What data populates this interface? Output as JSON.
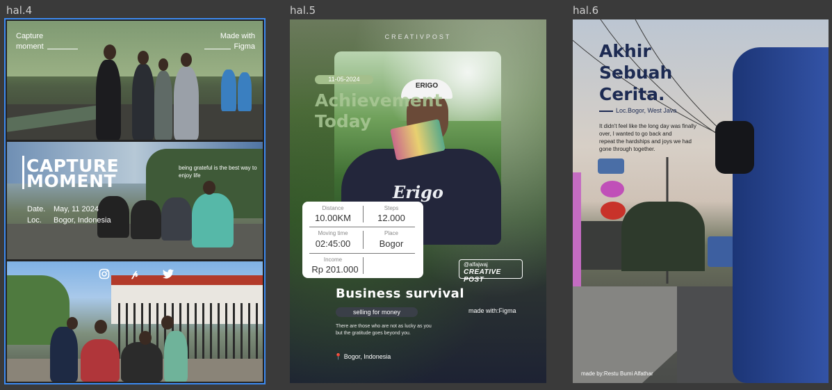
{
  "frames": [
    {
      "label": "hal.4"
    },
    {
      "label": "hal.5"
    },
    {
      "label": "hal.6"
    }
  ],
  "hal4": {
    "top_left": "Capture\nmoment",
    "top_right": "Made with\nFigma",
    "title_line1": "CAPTURE",
    "title_line2": "MOMENT",
    "quote": "being grateful is the best way to enjoy life",
    "date_label": "Date.",
    "date_value": "May, 11 2024",
    "loc_label": "Loc.",
    "loc_value": "Bogor, Indonesia",
    "social_icons": [
      "instagram-icon",
      "pinterest-icon",
      "twitter-icon"
    ]
  },
  "hal5": {
    "brand": "CREATIVPOST",
    "date": "11-05-2024",
    "headline_line1": "Achievement",
    "headline_line2": "Today",
    "shirt_text": "Erigo",
    "cap_text": "ERIGO",
    "stats": [
      {
        "label": "Distance",
        "value": "10.00KM"
      },
      {
        "label": "Steps",
        "value": "12.000"
      },
      {
        "label": "Moving time",
        "value": "02:45:00"
      },
      {
        "label": "Place",
        "value": "Bogor"
      },
      {
        "label": "Income",
        "value": "Rp 201.000"
      }
    ],
    "handle": "@alfajwaj",
    "handle_brand": "CREATIVE POST",
    "title": "Business survival",
    "pill": "selling for money",
    "made_with": "made with:Figma",
    "body_line1": "There are those who are not as lucky as you",
    "body_line2": "but the gratitude goes beyond you.",
    "location": "Bogor, Indonesia"
  },
  "hal6": {
    "title_line1": "Akhir",
    "title_line2": "Sebuah",
    "title_line3": "Cerita.",
    "loc": "Loc.Bogor, West Java",
    "body_line1": "It didn't feel like the long day was finally",
    "body_line2": "over, I wanted to go back and",
    "body_line3": "repeat the hardships and joys we had",
    "body_line4": "gone through together.",
    "credit": "made by:Restu Bumi Alfathar"
  },
  "colors": {
    "selection": "#3d8bf2",
    "canvas": "#3a3a3a",
    "navy": "#1c2a52"
  }
}
